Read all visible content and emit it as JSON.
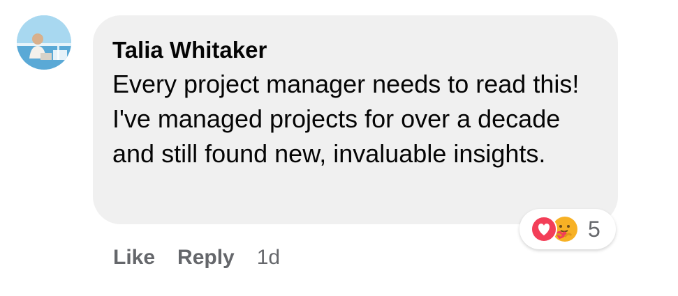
{
  "comment": {
    "author": "Talia Whitaker",
    "text": "Every project manager needs to read this! I've managed projects for over a decade and still found new, invaluable insights.",
    "reactions": {
      "icons": [
        "love-icon",
        "care-icon"
      ],
      "count": "5"
    },
    "actions": {
      "like_label": "Like",
      "reply_label": "Reply",
      "timestamp": "1d"
    }
  },
  "colors": {
    "bubble_bg": "#f0f0f0",
    "secondary_text": "#65676b",
    "love_red": "#f33e58",
    "care_yellow": "#f7b125"
  }
}
